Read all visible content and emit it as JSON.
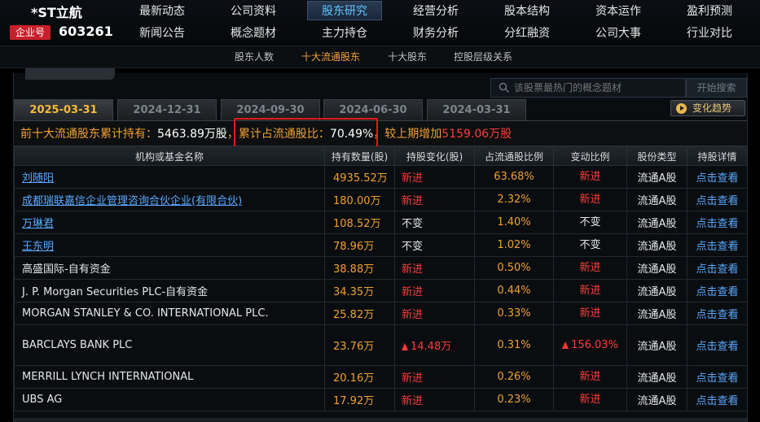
{
  "header": {
    "stock_name": "*ST立航",
    "board_badge": "企业号",
    "stock_code": "603261",
    "nav_row1": [
      "最新动态",
      "公司资料",
      "股东研究",
      "经营分析",
      "股本结构",
      "资本运作",
      "盈利预测"
    ],
    "nav_row2": [
      "新闻公告",
      "概念题材",
      "主力持仓",
      "财务分析",
      "分红融资",
      "公司大事",
      "行业对比"
    ],
    "active_nav": "股东研究"
  },
  "subnav": {
    "items": [
      "股东人数",
      "十大流通股东",
      "十大股东",
      "控股层级关系"
    ],
    "active": "十大流通股东"
  },
  "search": {
    "placeholder": "该股票最热门的概念题材",
    "button_label": "开始搜索"
  },
  "date_tabs": [
    "2025-03-31",
    "2024-12-31",
    "2024-09-30",
    "2024-06-30",
    "2024-03-31"
  ],
  "active_date": "2025-03-31",
  "trend_button": "变化趋势",
  "summary": {
    "part1_label": "前十大流通股东累计持有：",
    "part1_value": "5463.89万股",
    "part2_label": "累计占流通股比：",
    "part2_value": "70.49%",
    "part3_label": "较上期增加",
    "part3_value": "5159.06万股"
  },
  "table": {
    "headers": [
      "机构或基金名称",
      "持有数量(股)",
      "持股变化(股)",
      "占流通股比例",
      "变动比例",
      "股份类型",
      "持股详情"
    ],
    "rows": [
      {
        "name": "刘随阳",
        "link": true,
        "qty": "4935.52万",
        "change": "新进",
        "ratio": "63.68%",
        "ratio_change": "新进",
        "type": "流通A股",
        "detail": "点击查看"
      },
      {
        "name": "成都瑞联嘉信企业管理咨询合伙企业(有限合伙)",
        "link": true,
        "qty": "180.00万",
        "change": "新进",
        "ratio": "2.32%",
        "ratio_change": "新进",
        "type": "流通A股",
        "detail": "点击查看"
      },
      {
        "name": "万琳君",
        "link": true,
        "qty": "108.52万",
        "change": "不变",
        "ratio": "1.40%",
        "ratio_change": "不变",
        "type": "流通A股",
        "detail": "点击查看"
      },
      {
        "name": "王东明",
        "link": true,
        "qty": "78.96万",
        "change": "不变",
        "ratio": "1.02%",
        "ratio_change": "不变",
        "type": "流通A股",
        "detail": "点击查看"
      },
      {
        "name": "高盛国际-自有资金",
        "link": false,
        "qty": "38.88万",
        "change": "新进",
        "ratio": "0.50%",
        "ratio_change": "新进",
        "type": "流通A股",
        "detail": "点击查看"
      },
      {
        "name": "J. P. Morgan Securities PLC-自有资金",
        "link": false,
        "qty": "34.35万",
        "change": "新进",
        "ratio": "0.44%",
        "ratio_change": "新进",
        "type": "流通A股",
        "detail": "点击查看"
      },
      {
        "name": "MORGAN STANLEY & CO. INTERNATIONAL PLC.",
        "link": false,
        "qty": "25.82万",
        "change": "新进",
        "ratio": "0.33%",
        "ratio_change": "新进",
        "type": "流通A股",
        "detail": "点击查看"
      },
      {
        "name": "BARCLAYS BANK PLC",
        "link": false,
        "qty": "23.76万",
        "change": "14.48万",
        "change_up": true,
        "ratio": "0.31%",
        "ratio_change": "156.03%",
        "ratio_up": true,
        "type": "流通A股",
        "detail": "点击查看"
      },
      {
        "name": "MERRILL LYNCH INTERNATIONAL",
        "link": false,
        "qty": "20.16万",
        "change": "新进",
        "ratio": "0.26%",
        "ratio_change": "新进",
        "type": "流通A股",
        "detail": "点击查看"
      },
      {
        "name": "UBS AG",
        "link": false,
        "qty": "17.92万",
        "change": "新进",
        "ratio": "0.23%",
        "ratio_change": "新进",
        "type": "流通A股",
        "detail": "点击查看"
      }
    ]
  }
}
